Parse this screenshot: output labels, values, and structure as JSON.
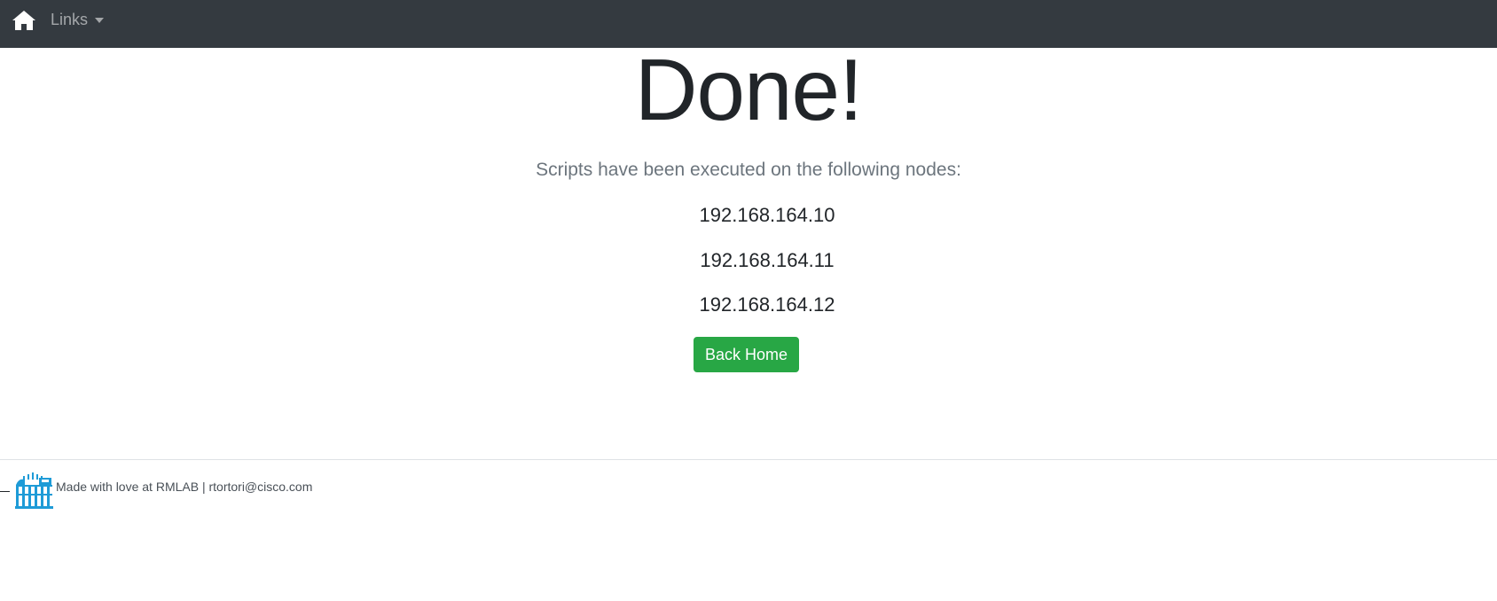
{
  "navbar": {
    "home_icon": "home-icon",
    "links_label": "Links"
  },
  "main": {
    "title": "Done!",
    "subtitle": "Scripts have been executed on the following nodes:",
    "nodes": [
      "192.168.164.10",
      "192.168.164.11",
      "192.168.164.12"
    ],
    "back_button_label": "Back Home"
  },
  "footer": {
    "logo": "colosseum-logo",
    "text": "Made with love at RMLAB | rtortori@cisco.com"
  },
  "colors": {
    "navbar_bg": "#343a40",
    "button_green": "#28a745",
    "logo_blue": "#1e9bd7"
  }
}
